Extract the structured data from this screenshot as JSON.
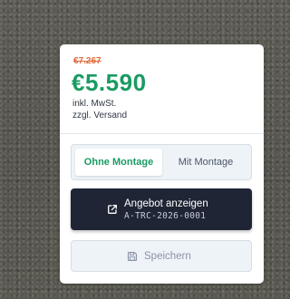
{
  "price": {
    "old": "€7.267",
    "current": "€5.590",
    "tax_note": "inkl. MwSt.",
    "shipping_note": "zzgl. Versand"
  },
  "mounting_toggle": {
    "options": [
      "Ohne Montage",
      "Mit Montage"
    ],
    "selected": "Ohne Montage"
  },
  "offer_button": {
    "label": "Angebot anzeigen",
    "reference": "A-TRC-2026-0001",
    "icon": "external-link-icon"
  },
  "save_button": {
    "label": "Speichern",
    "icon": "save-icon"
  },
  "colors": {
    "price_green": "#1a9b62",
    "old_price_orange": "#e06b3a",
    "button_dark": "#1f2535"
  }
}
